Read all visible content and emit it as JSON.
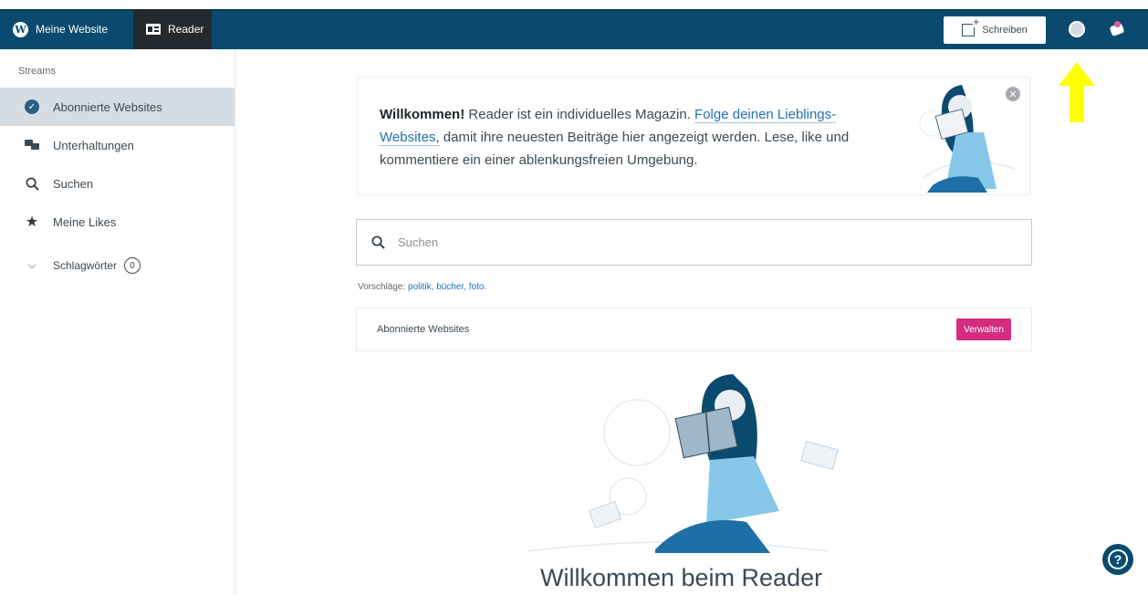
{
  "topbar": {
    "site_label": "Meine Website",
    "reader_label": "Reader",
    "write_label": "Schreiben",
    "site_icon": "wordpress-icon",
    "reader_icon": "reader-icon",
    "avatar_icon": "avatar-icon",
    "notifications_icon": "notifications-icon"
  },
  "sidebar": {
    "heading": "Streams",
    "items": [
      {
        "label": "Abonnierte Websites",
        "icon": "check-circle-icon"
      },
      {
        "label": "Unterhaltungen",
        "icon": "chat-icon"
      },
      {
        "label": "Suchen",
        "icon": "search-icon"
      },
      {
        "label": "Meine Likes",
        "icon": "star-icon"
      },
      {
        "label": "Schlagwörter",
        "icon": "chevron-down-icon",
        "count": "0"
      }
    ]
  },
  "welcome": {
    "bold": "Willkommen!",
    "text1": " Reader ist ein individuelles Magazin. ",
    "link": "Folge deinen Lieblings-Websites,",
    "text2": " damit ihre neuesten Beiträge hier angezeigt werden. Lese, like und kommentiere ein einer ablenkungsfreien Umgebung."
  },
  "search": {
    "placeholder": "Suchen",
    "suggestions_prefix": "Vorschläge: ",
    "suggestions": [
      "politik",
      "bücher",
      "foto"
    ]
  },
  "subscriptions": {
    "label": "Abonnierte Websites",
    "manage_label": "Verwalten"
  },
  "main_title": "Willkommen beim Reader",
  "colors": {
    "topbar": "#0a4a6e",
    "accent_pink": "#d52c82",
    "link_blue": "#2271b1",
    "arrow_yellow": "#ffff00"
  }
}
